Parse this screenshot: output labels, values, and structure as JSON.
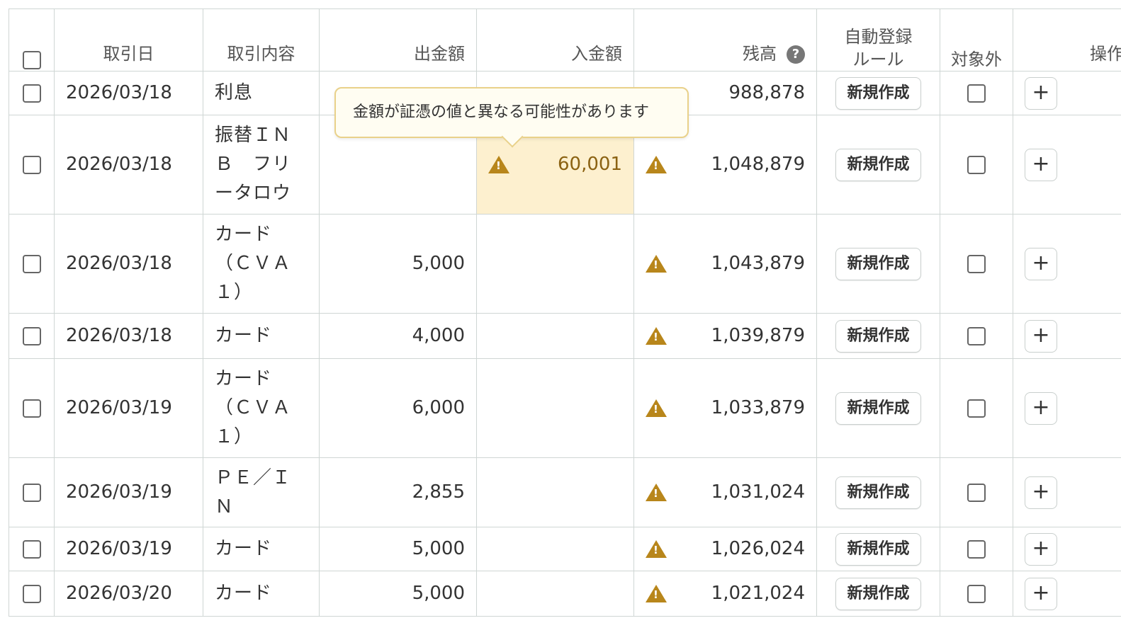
{
  "headers": {
    "select_all": "",
    "date": "取引日",
    "description": "取引内容",
    "withdrawal": "出金額",
    "deposit": "入金額",
    "balance": "残高",
    "balance_help": "?",
    "auto_rule_line1": "自動登録",
    "auto_rule_line2": "ルール",
    "excluded": "対象外",
    "actions": "操作"
  },
  "tooltip": "金額が証憑の値と異なる可能性があります",
  "new_button_label": "新規作成",
  "plus_label": "+",
  "colors": {
    "warning": "#b8861b",
    "highlight": "#fdf0cf"
  },
  "rows": [
    {
      "date": "2026/03/18",
      "description": "利息",
      "withdrawal": "",
      "deposit": "",
      "balance": "988,878",
      "deposit_warn": false,
      "balance_warn": false
    },
    {
      "date": "2026/03/18",
      "description": "振替ＩＮ Ｂ　フリ ータロウ",
      "withdrawal": "",
      "deposit": "60,001",
      "balance": "1,048,879",
      "deposit_warn": true,
      "balance_warn": true
    },
    {
      "date": "2026/03/18",
      "description": "カード （ＣＶＡ １）",
      "withdrawal": "5,000",
      "deposit": "",
      "balance": "1,043,879",
      "deposit_warn": false,
      "balance_warn": true
    },
    {
      "date": "2026/03/18",
      "description": "カード",
      "withdrawal": "4,000",
      "deposit": "",
      "balance": "1,039,879",
      "deposit_warn": false,
      "balance_warn": true
    },
    {
      "date": "2026/03/19",
      "description": "カード （ＣＶＡ １）",
      "withdrawal": "6,000",
      "deposit": "",
      "balance": "1,033,879",
      "deposit_warn": false,
      "balance_warn": true
    },
    {
      "date": "2026/03/19",
      "description": "ＰＥ／Ｉ Ｎ",
      "withdrawal": "2,855",
      "deposit": "",
      "balance": "1,031,024",
      "deposit_warn": false,
      "balance_warn": true
    },
    {
      "date": "2026/03/19",
      "description": "カード",
      "withdrawal": "5,000",
      "deposit": "",
      "balance": "1,026,024",
      "deposit_warn": false,
      "balance_warn": true
    },
    {
      "date": "2026/03/20",
      "description": "カード",
      "withdrawal": "5,000",
      "deposit": "",
      "balance": "1,021,024",
      "deposit_warn": false,
      "balance_warn": true
    }
  ]
}
